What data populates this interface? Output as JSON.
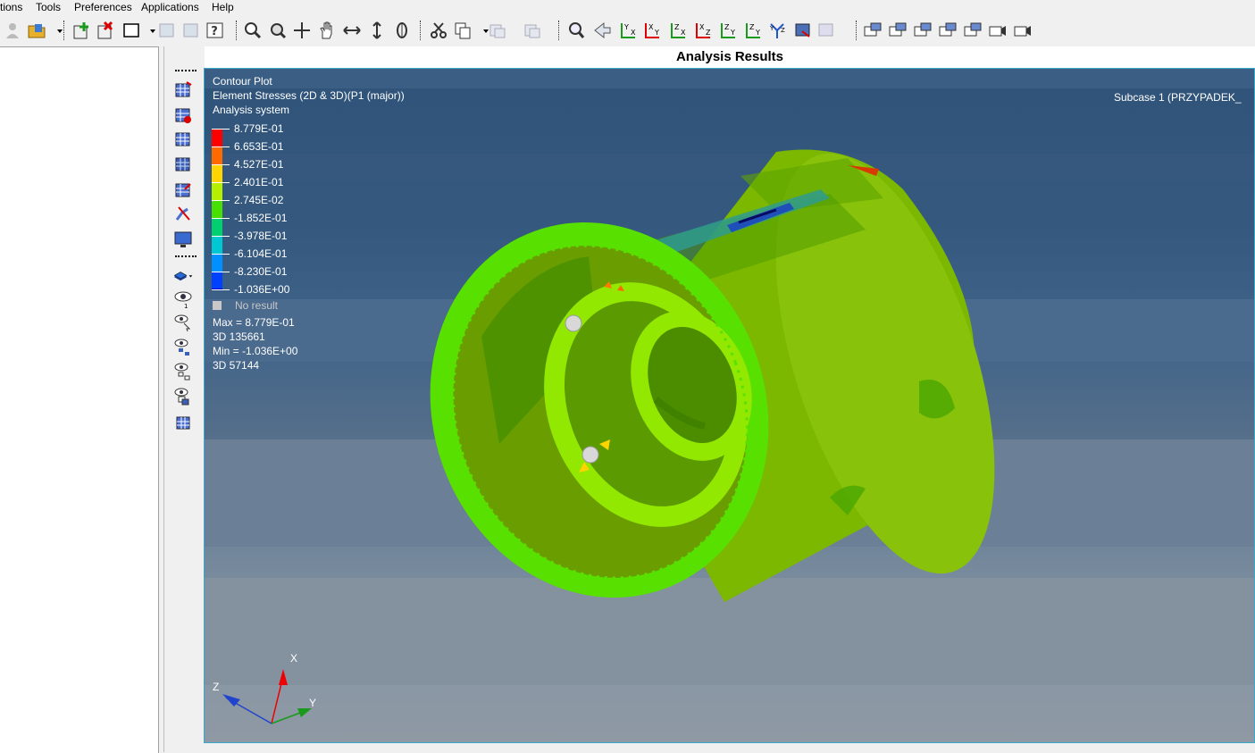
{
  "menu": {
    "items": [
      "tions",
      "Tools",
      "Preferences",
      "Applications",
      "Help"
    ]
  },
  "title": "Analysis Results",
  "viewport": {
    "plot_type": "Contour Plot",
    "result": "Element Stresses (2D & 3D)(P1 (major))",
    "system": "Analysis system",
    "subcase": "Subcase 1 (PRZYPADEK_",
    "legend": {
      "values": [
        "8.779E-01",
        "6.653E-01",
        "4.527E-01",
        "2.401E-01",
        "2.745E-02",
        "-1.852E-01",
        "-3.978E-01",
        "-6.104E-01",
        "-8.230E-01",
        "-1.036E+00"
      ],
      "colors": [
        "#ff0000",
        "#ff6a00",
        "#ffd400",
        "#b4f000",
        "#48e000",
        "#00d070",
        "#00c8d2",
        "#0090ff",
        "#0040ff",
        "#0000c8"
      ],
      "no_result": "No result",
      "no_result_color": "#c8c8c8"
    },
    "stats": {
      "max": "Max = 8.779E-01",
      "max_elem": "3D 135661",
      "min": "Min = -1.036E+00",
      "min_elem": "3D 57144"
    },
    "triad": {
      "x": "X",
      "y": "Y",
      "z": "Z"
    }
  }
}
